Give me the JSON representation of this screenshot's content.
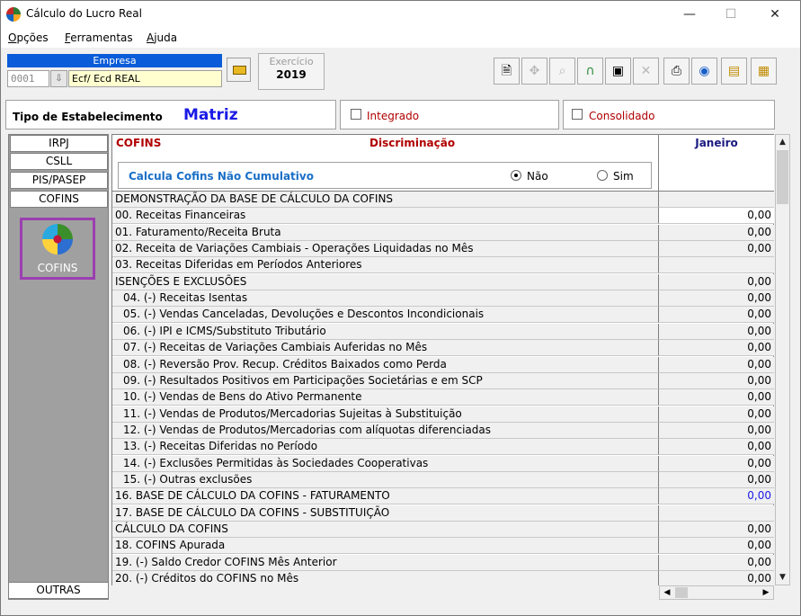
{
  "window": {
    "title": "Cálculo do Lucro Real",
    "minimize": "—",
    "maximize": "☐",
    "close": "✕"
  },
  "menu": [
    {
      "label": "Opções",
      "mnemonic": "O"
    },
    {
      "label": "Ferramentas",
      "mnemonic": "F"
    },
    {
      "label": "Ajuda",
      "mnemonic": "A"
    }
  ],
  "empresa": {
    "header": "Empresa",
    "code": "0001",
    "name": "Ecf/ Ecd REAL"
  },
  "exercicio": {
    "label": "Exercício",
    "value": "2019"
  },
  "toolbar_icons": [
    "new-document-icon",
    "settings-icon",
    "search-icon",
    "lock-icon",
    "save-icon",
    "delete-icon",
    "print-icon",
    "export-icon",
    "folders-icon",
    "report-icon"
  ],
  "estabelecimento": {
    "label": "Tipo de Estabelecimento",
    "value": "Matriz"
  },
  "integrado": {
    "label": "Integrado",
    "checked": false
  },
  "consolidado": {
    "label": "Consolidado",
    "checked": false
  },
  "tabs": [
    "IRPJ",
    "CSLL",
    "PIS/PASEP",
    "COFINS"
  ],
  "side_icon_label": "COFINS",
  "bottom_tab": "OUTRAS",
  "grid": {
    "key_header": "COFINS",
    "desc_header": "Discriminação",
    "month_header": "Janeiro",
    "question": "Calcula Cofins Não Cumulativo",
    "option_no": "Não",
    "option_yes": "Sim",
    "selected": "Não",
    "rows": [
      {
        "label": "DEMONSTRAÇÃO DA BASE DE CÁLCULO DA COFINS",
        "value": ""
      },
      {
        "label": "00. Receitas Financeiras",
        "value": "0,00"
      },
      {
        "label": "01. Faturamento/Receita Bruta",
        "value": "0,00"
      },
      {
        "label": "02. Receita de Variações Cambiais - Operações Liquidadas no Mês",
        "value": "0,00"
      },
      {
        "label": "03. Receitas Diferidas em Períodos Anteriores",
        "value": ""
      },
      {
        "label": "ISENÇÕES E EXCLUSÕES",
        "value": "0,00"
      },
      {
        "label": "04. (-) Receitas Isentas",
        "value": "0,00"
      },
      {
        "label": "05. (-) Vendas Canceladas, Devoluções e Descontos Incondicionais",
        "value": "0,00"
      },
      {
        "label": "06. (-) IPI e ICMS/Substituto Tributário",
        "value": "0,00"
      },
      {
        "label": "07. (-) Receitas de Variações Cambiais Auferidas no Mês",
        "value": "0,00"
      },
      {
        "label": "08. (-) Reversão Prov. Recup. Créditos Baixados como Perda",
        "value": "0,00"
      },
      {
        "label": "09. (-) Resultados Positivos em Participações Societárias e em SCP",
        "value": "0,00"
      },
      {
        "label": "10. (-) Vendas de Bens do Ativo Permanente",
        "value": "0,00"
      },
      {
        "label": "11. (-) Vendas de Produtos/Mercadorias Sujeitas à Substituição",
        "value": "0,00"
      },
      {
        "label": "12. (-) Vendas de Produtos/Mercadorias com alíquotas diferenciadas",
        "value": "0,00"
      },
      {
        "label": "13. (-) Receitas Diferidas no Período",
        "value": "0,00"
      },
      {
        "label": "14. (-) Exclusões Permitidas às Sociedades Cooperativas",
        "value": "0,00"
      },
      {
        "label": "15. (-) Outras exclusões",
        "value": "0,00"
      },
      {
        "label": "16. BASE DE CÁLCULO DA COFINS - FATURAMENTO",
        "value": "0,00"
      },
      {
        "label": "17. BASE DE CÁLCULO DA COFINS - SUBSTITUIÇÃO",
        "value": ""
      },
      {
        "label": "CÁLCULO DA COFINS",
        "value": "0,00"
      },
      {
        "label": "18. COFINS Apurada",
        "value": "0,00"
      },
      {
        "label": "19. (-) Saldo Credor COFINS Mês Anterior",
        "value": "0,00"
      },
      {
        "label": "20. (-) Créditos do COFINS no Mês",
        "value": "0,00"
      }
    ]
  }
}
